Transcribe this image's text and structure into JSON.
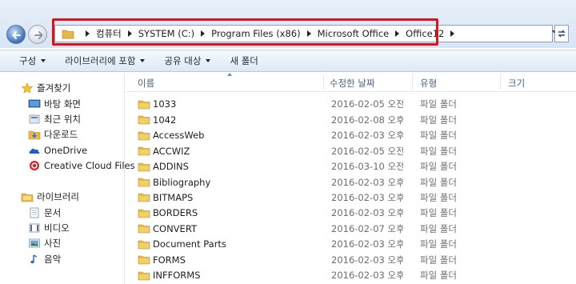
{
  "address": {
    "crumbs": [
      "컴퓨터",
      "SYSTEM (C:)",
      "Program Files (x86)",
      "Microsoft Office",
      "Office12"
    ]
  },
  "toolbar": {
    "organize": "구성",
    "include_library": "라이브러리에 포함",
    "share_with": "공유 대상",
    "new_folder": "새 폴더"
  },
  "nav": {
    "favorites": "즐겨찾기",
    "desktop": "바탕 화면",
    "recent": "최근 위치",
    "downloads": "다운로드",
    "onedrive": "OneDrive",
    "ccfiles": "Creative Cloud Files",
    "libraries": "라이브러리",
    "documents": "문서",
    "videos": "비디오",
    "pictures": "사진",
    "music": "음악"
  },
  "columns": {
    "name": "이름",
    "modified": "수정한 날짜",
    "type": "유형",
    "size": "크기"
  },
  "files": [
    {
      "name": "1033",
      "date": "2016-02-05 오전...",
      "type": "파일 폴더"
    },
    {
      "name": "1042",
      "date": "2016-02-08 오후...",
      "type": "파일 폴더"
    },
    {
      "name": "AccessWeb",
      "date": "2016-02-03 오후...",
      "type": "파일 폴더"
    },
    {
      "name": "ACCWIZ",
      "date": "2016-02-05 오전...",
      "type": "파일 폴더"
    },
    {
      "name": "ADDINS",
      "date": "2016-03-10 오전...",
      "type": "파일 폴더"
    },
    {
      "name": "Bibliography",
      "date": "2016-02-03 오후...",
      "type": "파일 폴더"
    },
    {
      "name": "BITMAPS",
      "date": "2016-02-03 오후...",
      "type": "파일 폴더"
    },
    {
      "name": "BORDERS",
      "date": "2016-02-03 오후...",
      "type": "파일 폴더"
    },
    {
      "name": "CONVERT",
      "date": "2016-02-07 오후...",
      "type": "파일 폴더"
    },
    {
      "name": "Document Parts",
      "date": "2016-02-03 오후...",
      "type": "파일 폴더"
    },
    {
      "name": "FORMS",
      "date": "2016-02-03 오후...",
      "type": "파일 폴더"
    },
    {
      "name": "INFFORMS",
      "date": "2016-02-03 오후...",
      "type": "파일 폴더"
    }
  ],
  "colors": {
    "highlight_box": "#e0101c",
    "folder": "#e8b94a",
    "header_text": "#4c607a"
  }
}
